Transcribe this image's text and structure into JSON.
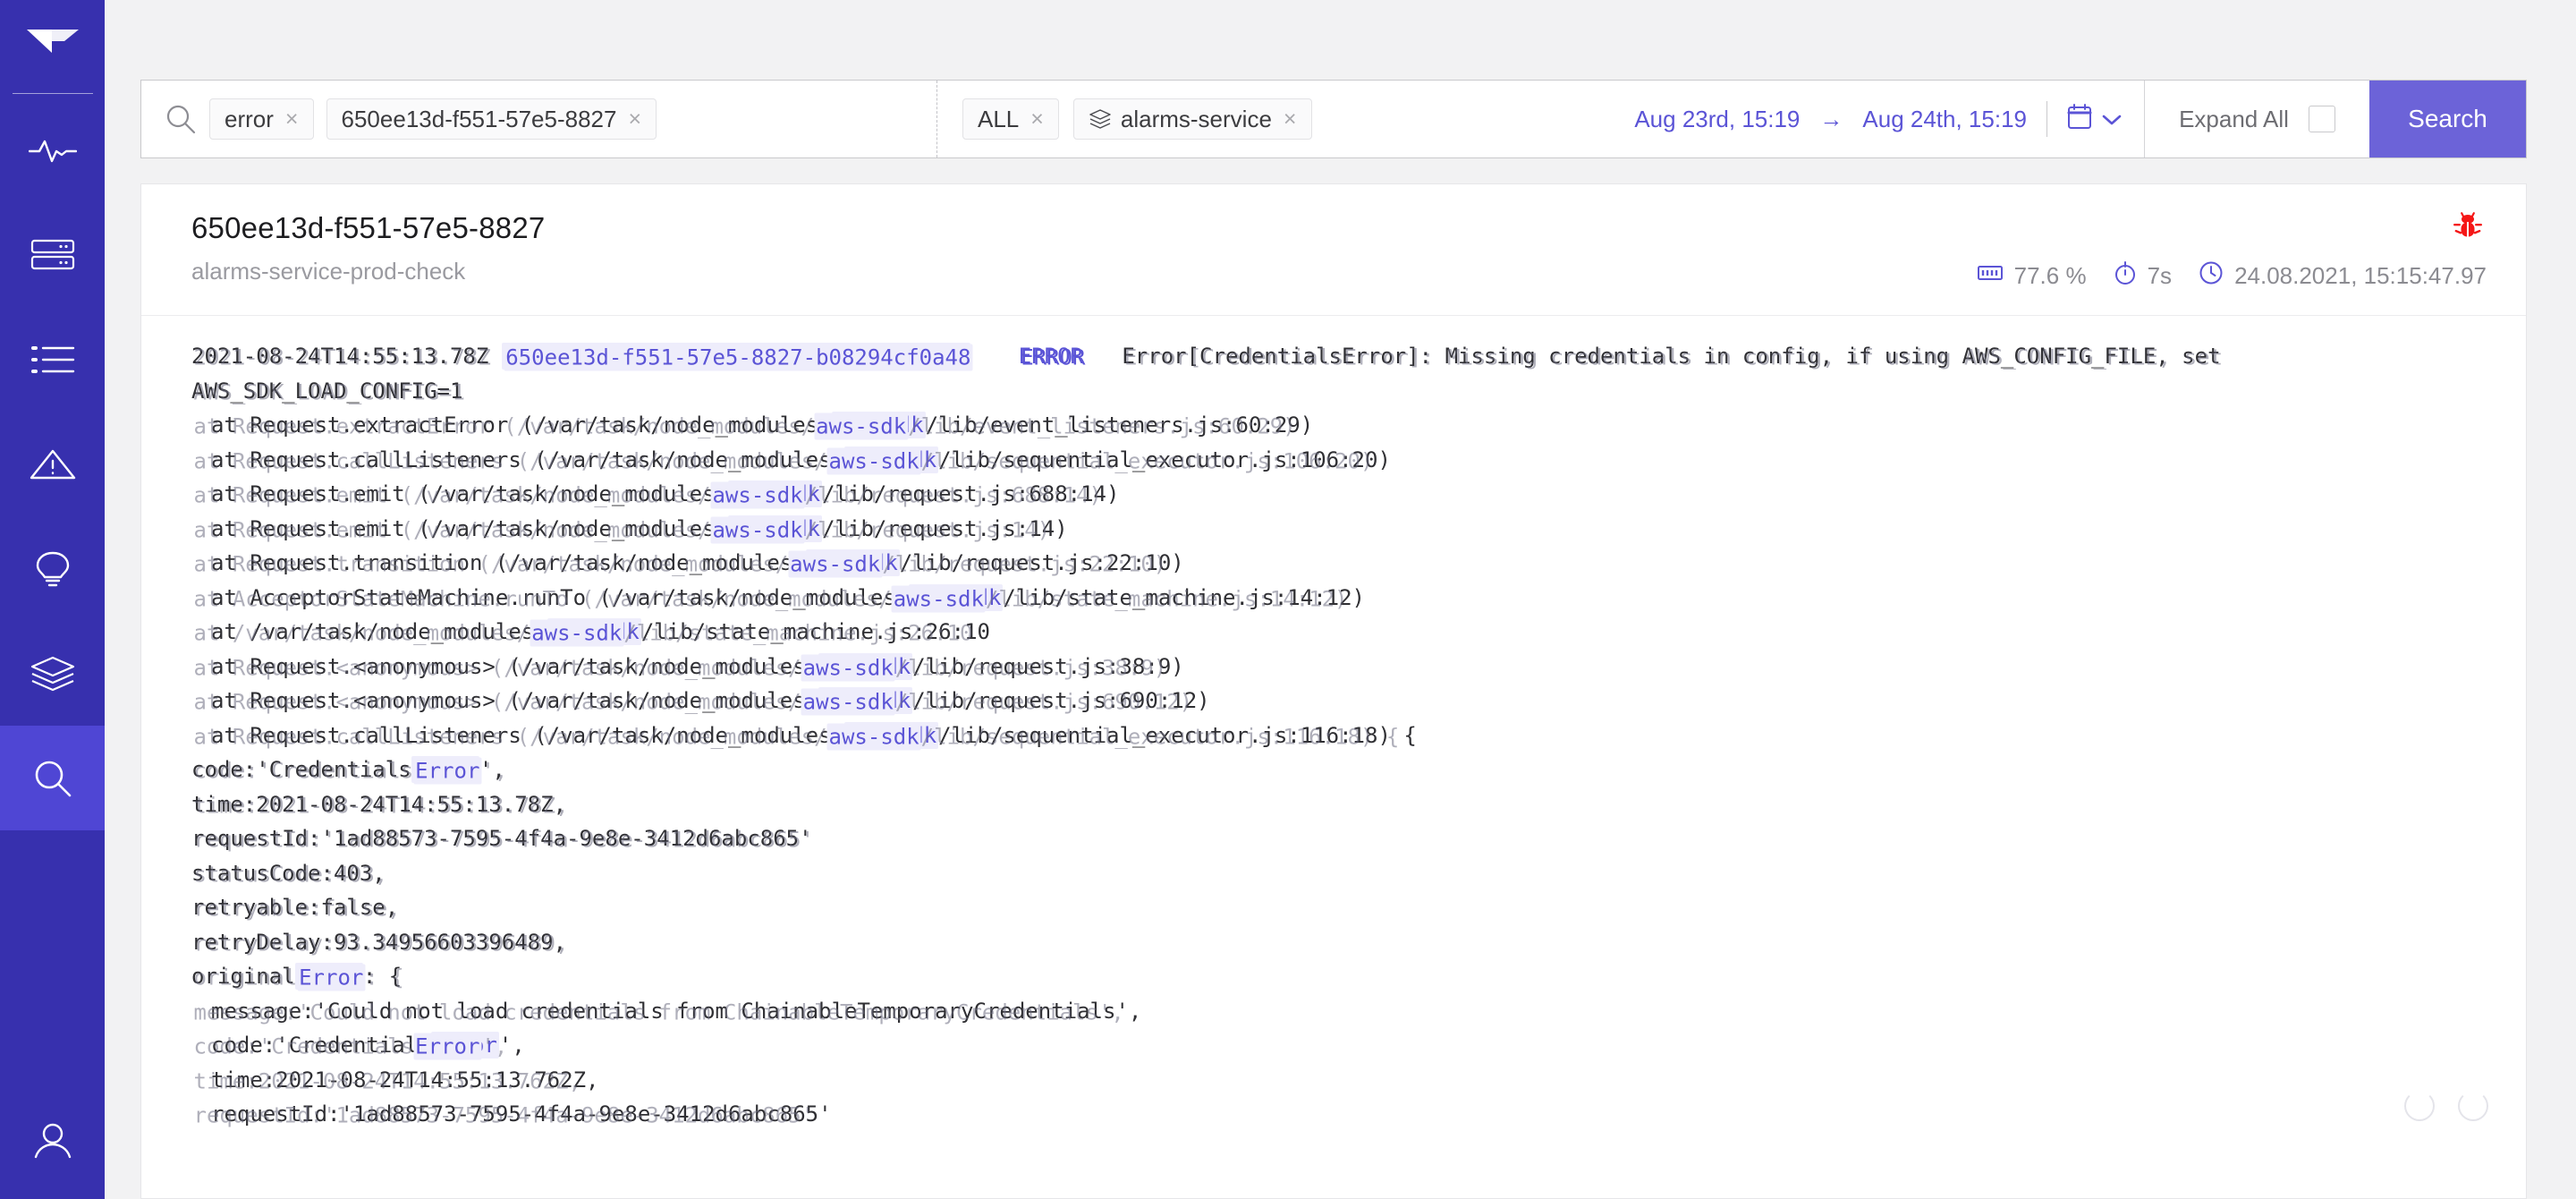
{
  "sidebar": {
    "logo": "bird-logo",
    "items": [
      {
        "name": "activity",
        "icon": "pulse-icon",
        "active": false
      },
      {
        "name": "servers",
        "icon": "server-icon",
        "active": false
      },
      {
        "name": "list",
        "icon": "list-icon",
        "active": false
      },
      {
        "name": "alerts",
        "icon": "warning-triangle-icon",
        "active": false
      },
      {
        "name": "insights",
        "icon": "lightbulb-icon",
        "active": false
      },
      {
        "name": "services",
        "icon": "layers-icon",
        "active": false
      },
      {
        "name": "search",
        "icon": "search-icon",
        "active": true
      }
    ],
    "account_icon": "user-icon",
    "bg_color": "#3730ae",
    "active_color": "#4f46d4"
  },
  "search": {
    "query_chips": [
      {
        "label": "error",
        "remove": "×"
      },
      {
        "label": "650ee13d-f551-57e5-8827",
        "remove": "×"
      }
    ],
    "filter_chips": [
      {
        "label": "ALL",
        "icon": null,
        "remove": "×"
      },
      {
        "label": "alarms-service",
        "icon": "layers-icon",
        "remove": "×"
      }
    ],
    "date_from": "Aug 23rd, 15:19",
    "date_arrow": "→",
    "date_to": "Aug 24th, 15:19",
    "calendar_icon": "calendar-icon",
    "chevron_icon": "chevron-down-icon",
    "expand_all_label": "Expand All",
    "expand_all_checked": false,
    "search_button_label": "Search",
    "accent_color": "#5b54d6",
    "button_color": "#6c63d8"
  },
  "result": {
    "trace_id": "650ee13d-f551-57e5-8827",
    "service_name": "alarms-service-prod-check",
    "status_icon": "bug-icon",
    "status_color": "#f51717",
    "memory_icon": "memory-chip-icon",
    "memory": "77.6 %",
    "duration_icon": "stopwatch-icon",
    "duration": "7s",
    "time_icon": "clock-icon",
    "timestamp": "24.08.2021, 15:15:47.97"
  },
  "log": {
    "lines": [
      {
        "indent": 0,
        "segments": [
          {
            "t": "2021-08-24T14:55:13.78Z\t",
            "s": "plain"
          },
          {
            "t": "650ee13d-f551-57e5-8827-b08294cf0a48",
            "s": "hl"
          },
          {
            "t": "\t",
            "s": "plain"
          },
          {
            "t": "ERROR",
            "s": "kw"
          },
          {
            "t": "\t",
            "s": "plain"
          },
          {
            "t": "Error[CredentialsError]: Missing credentials in config, if using AWS_CONFIG_FILE, set",
            "s": "plain"
          }
        ]
      },
      {
        "indent": 0,
        "segments": [
          {
            "t": "AWS_SDK_LOAD_CONFIG=1",
            "s": "plain"
          }
        ]
      },
      {
        "indent": 1,
        "segments": [
          {
            "t": "at Request.extractError (/var/task/node_modules/",
            "s": "plain"
          },
          {
            "t": "aws-sdk",
            "s": "hl"
          },
          {
            "t": "/lib/event_listeners.js:60:29)",
            "s": "plain"
          }
        ]
      },
      {
        "indent": 1,
        "segments": [
          {
            "t": "at Request.callListeners (/var/task/node_modules/",
            "s": "plain"
          },
          {
            "t": "aws-sdk",
            "s": "hl"
          },
          {
            "t": "/lib/sequential_executor.js:106:20)",
            "s": "plain"
          }
        ]
      },
      {
        "indent": 1,
        "segments": [
          {
            "t": "at Request.emit (/var/task/node_modules/",
            "s": "plain"
          },
          {
            "t": "aws-sdk",
            "s": "hl"
          },
          {
            "t": "/lib/request.js:688:14)",
            "s": "plain"
          }
        ]
      },
      {
        "indent": 1,
        "segments": [
          {
            "t": "at Request.emit (/var/task/node_modules/",
            "s": "plain"
          },
          {
            "t": "aws-sdk",
            "s": "hl"
          },
          {
            "t": "/lib/request.js:14)",
            "s": "plain"
          }
        ]
      },
      {
        "indent": 1,
        "segments": [
          {
            "t": "at Request.transition (/var/task/node_modules/",
            "s": "plain"
          },
          {
            "t": "aws-sdk",
            "s": "hl"
          },
          {
            "t": "/lib/request.js:22:10)",
            "s": "plain"
          }
        ]
      },
      {
        "indent": 1,
        "segments": [
          {
            "t": "at AcceptorStateMachine.runTo (/var/task/node_modules/",
            "s": "plain"
          },
          {
            "t": "aws-sdk",
            "s": "hl"
          },
          {
            "t": "/lib/state_machine.js:14:12)",
            "s": "plain"
          }
        ]
      },
      {
        "indent": 1,
        "segments": [
          {
            "t": "at /var/task/node_modules/",
            "s": "plain"
          },
          {
            "t": "aws-sdk",
            "s": "hl"
          },
          {
            "t": "/lib/state_machine.js:26:10",
            "s": "plain"
          }
        ]
      },
      {
        "indent": 1,
        "segments": [
          {
            "t": "at Request.<anonymous> (/var/task/node_modules/",
            "s": "plain"
          },
          {
            "t": "aws-sdk",
            "s": "hl"
          },
          {
            "t": "/lib/request.js:38:9)",
            "s": "plain"
          }
        ]
      },
      {
        "indent": 1,
        "segments": [
          {
            "t": "at Request.<anonymous> (/var/task/node_modules/",
            "s": "plain"
          },
          {
            "t": "aws-sdk",
            "s": "hl"
          },
          {
            "t": "/lib/request.js:690:12)",
            "s": "plain"
          }
        ]
      },
      {
        "indent": 1,
        "segments": [
          {
            "t": "at Request.callListeners (/var/task/node_modules/",
            "s": "plain"
          },
          {
            "t": "aws-sdk",
            "s": "hl"
          },
          {
            "t": "/lib/sequential_executor.js:116:18) {",
            "s": "plain"
          }
        ]
      },
      {
        "indent": 0,
        "segments": [
          {
            "t": "code:'Credentials",
            "s": "plain"
          },
          {
            "t": "Error",
            "s": "hl"
          },
          {
            "t": "',",
            "s": "plain"
          }
        ]
      },
      {
        "indent": 0,
        "segments": [
          {
            "t": "time:2021-08-24T14:55:13.78Z,",
            "s": "plain"
          }
        ]
      },
      {
        "indent": 0,
        "segments": [
          {
            "t": "requestId:'1ad88573-7595-4f4a-9e8e-3412d6abc865'",
            "s": "plain"
          }
        ]
      },
      {
        "indent": 0,
        "segments": [
          {
            "t": "statusCode:403,",
            "s": "plain"
          }
        ]
      },
      {
        "indent": 0,
        "segments": [
          {
            "t": "retryable:false,",
            "s": "plain"
          }
        ]
      },
      {
        "indent": 0,
        "segments": [
          {
            "t": "retryDelay:93.34956603396489,",
            "s": "plain"
          }
        ]
      },
      {
        "indent": 0,
        "segments": [
          {
            "t": "original",
            "s": "plain"
          },
          {
            "t": "Error",
            "s": "hl"
          },
          {
            "t": ": {",
            "s": "plain"
          }
        ]
      },
      {
        "indent": 1,
        "segments": [
          {
            "t": "message:'Could not load credentials from ChainableTemporaryCredentials',",
            "s": "plain"
          }
        ]
      },
      {
        "indent": 1,
        "segments": [
          {
            "t": "code:'Credentials",
            "s": "plain"
          },
          {
            "t": "Error",
            "s": "hl"
          },
          {
            "t": "',",
            "s": "plain"
          }
        ]
      },
      {
        "indent": 1,
        "segments": [
          {
            "t": "time:2021-08-24T14:55:13.762Z,",
            "s": "plain"
          }
        ]
      },
      {
        "indent": 1,
        "segments": [
          {
            "t": "requestId:'1ad88573-7595-4f4a-9e8e-3412d6abc865'",
            "s": "plain"
          }
        ]
      }
    ]
  }
}
